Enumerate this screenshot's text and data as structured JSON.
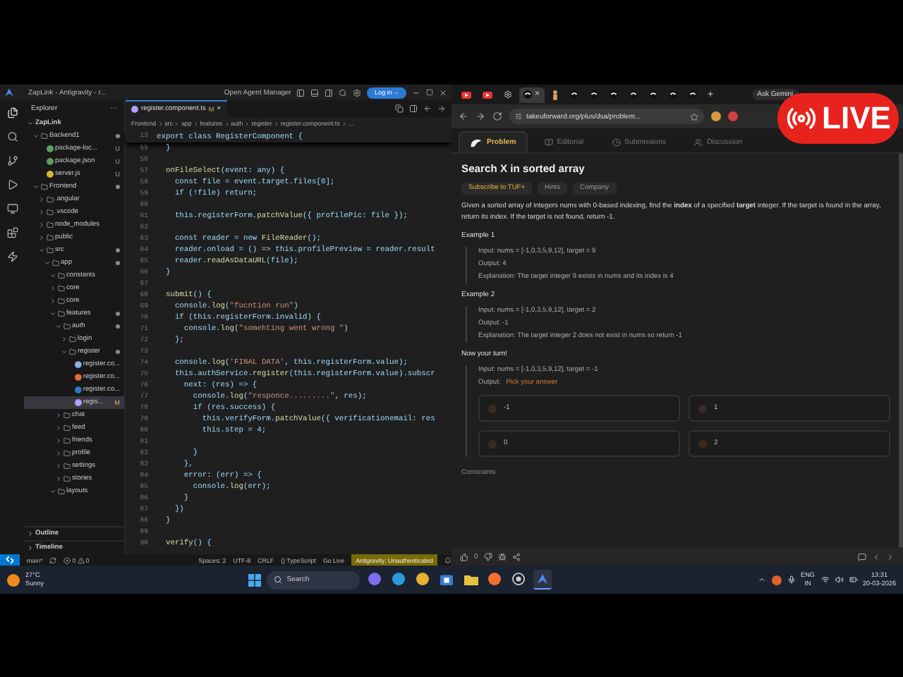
{
  "vscode": {
    "title": "ZapLink - Antigravity - r...",
    "agent_manager": "Open Agent Manager",
    "login_button": "Log in",
    "explorer": {
      "title": "Explorer",
      "more": "···",
      "tree": [
        {
          "label": "ZapLink",
          "kind": "root",
          "expanded": true,
          "selected": false,
          "dot": false,
          "children": [
            {
              "label": "Backend1",
              "kind": "folder",
              "expanded": true,
              "selected": false,
              "dot": true,
              "children": [
                {
                  "label": "package-loc...",
                  "kind": "json",
                  "selected": false,
                  "dot": false,
                  "badge": "U"
                },
                {
                  "label": "package.json",
                  "kind": "json",
                  "selected": false,
                  "dot": false,
                  "badge": "U"
                },
                {
                  "label": "server.js",
                  "kind": "js",
                  "selected": false,
                  "dot": false,
                  "badge": "U"
                }
              ]
            },
            {
              "label": "Frontend",
              "kind": "folder",
              "expanded": true,
              "selected": false,
              "dot": true,
              "children": [
                {
                  "label": ".angular",
                  "kind": "folder",
                  "expanded": false,
                  "selected": false,
                  "dot": false
                },
                {
                  "label": ".vscode",
                  "kind": "folder",
                  "expanded": false,
                  "selected": false,
                  "dot": false
                },
                {
                  "label": "node_modules",
                  "kind": "folder",
                  "expanded": false,
                  "selected": false,
                  "dot": false
                },
                {
                  "label": "public",
                  "kind": "folder",
                  "expanded": false,
                  "selected": false,
                  "dot": false
                },
                {
                  "label": "src",
                  "kind": "folder",
                  "expanded": true,
                  "selected": false,
                  "dot": true,
                  "children": [
                    {
                      "label": "app",
                      "kind": "folder",
                      "expanded": true,
                      "selected": false,
                      "dot": true,
                      "children": [
                        {
                          "label": "constants",
                          "kind": "folder",
                          "expanded": true,
                          "selected": false,
                          "dot": false
                        },
                        {
                          "label": "core",
                          "kind": "folder",
                          "expanded": false,
                          "selected": false,
                          "dot": false
                        },
                        {
                          "label": "core",
                          "kind": "folder",
                          "expanded": false,
                          "selected": false,
                          "dot": false
                        },
                        {
                          "label": "features",
                          "kind": "folder",
                          "expanded": true,
                          "selected": false,
                          "dot": true,
                          "children": [
                            {
                              "label": "auth",
                              "kind": "folder",
                              "expanded": true,
                              "selected": false,
                              "dot": true,
                              "children": [
                                {
                                  "label": "login",
                                  "kind": "folder",
                                  "expanded": false,
                                  "selected": false,
                                  "dot": false
                                },
                                {
                                  "label": "register",
                                  "kind": "folder",
                                  "expanded": true,
                                  "selected": false,
                                  "dot": true,
                                  "children": [
                                    {
                                      "label": "register.co...",
                                      "kind": "braces",
                                      "selected": false,
                                      "dot": false
                                    },
                                    {
                                      "label": "register.co...",
                                      "kind": "html",
                                      "selected": false,
                                      "dot": false
                                    },
                                    {
                                      "label": "register.co...",
                                      "kind": "ts",
                                      "selected": false,
                                      "dot": false
                                    },
                                    {
                                      "label": "regis...",
                                      "kind": "angular",
                                      "selected": true,
                                      "dot": false,
                                      "badge": "M"
                                    }
                                  ]
                                }
                              ]
                            },
                            {
                              "label": "chat",
                              "kind": "folder",
                              "expanded": false,
                              "selected": false,
                              "dot": false
                            },
                            {
                              "label": "feed",
                              "kind": "folder",
                              "expanded": false,
                              "selected": false,
                              "dot": false
                            },
                            {
                              "label": "friends",
                              "kind": "folder",
                              "expanded": false,
                              "selected": false,
                              "dot": false
                            },
                            {
                              "label": "profile",
                              "kind": "folder",
                              "expanded": false,
                              "selected": false,
                              "dot": false
                            },
                            {
                              "label": "settings",
                              "kind": "folder",
                              "expanded": false,
                              "selected": false,
                              "dot": false
                            },
                            {
                              "label": "stories",
                              "kind": "folder",
                              "expanded": false,
                              "selected": false,
                              "dot": false
                            }
                          ]
                        },
                        {
                          "label": "layouts",
                          "kind": "folder",
                          "expanded": true,
                          "selected": false,
                          "dot": false
                        }
                      ]
                    }
                  ]
                }
              ]
            }
          ]
        }
      ],
      "sections": [
        "Outline",
        "Timeline"
      ]
    },
    "tab": {
      "label": "register.component.ts",
      "badge": "M",
      "close": "×"
    },
    "breadcrumbs": [
      "Frontend",
      "src",
      "app",
      "features",
      "auth",
      "register",
      "register.component.ts",
      "..."
    ],
    "sticky": {
      "n": "13",
      "text": "export class RegisterComponent {"
    },
    "lines": [
      {
        "n": "55",
        "text": "  }"
      },
      {
        "n": "56"
      },
      {
        "n": "57",
        "text": "  onFileSelect(event: any) {"
      },
      {
        "n": "58",
        "text": "    const file = event.target.files[0];"
      },
      {
        "n": "59",
        "text": "    if (!file) return;"
      },
      {
        "n": "60"
      },
      {
        "n": "61",
        "text": "    this.registerForm.patchValue({ profilePic: file });"
      },
      {
        "n": "62"
      },
      {
        "n": "63",
        "text": "    const reader = new FileReader();"
      },
      {
        "n": "64",
        "text": "    reader.onload = () => this.profilePreview = reader.result"
      },
      {
        "n": "65",
        "text": "    reader.readAsDataURL(file);"
      },
      {
        "n": "66",
        "text": "  }"
      },
      {
        "n": "67"
      },
      {
        "n": "68",
        "text": "  submit() {"
      },
      {
        "n": "69",
        "text": "    console.log(\"fucntion run\")"
      },
      {
        "n": "70",
        "text": "    if (this.registerForm.invalid) {"
      },
      {
        "n": "71",
        "text": "      console.log(\"somehting went wrong \")"
      },
      {
        "n": "72",
        "text": "    };"
      },
      {
        "n": "73"
      },
      {
        "n": "74",
        "text": "    console.log('FINAL DATA', this.registerForm.value);"
      },
      {
        "n": "75",
        "text": "    this.authService.register(this.registerForm.value).subscr"
      },
      {
        "n": "76",
        "text": "      next: (res) => {"
      },
      {
        "n": "77",
        "text": "        console.log(\"responce.........\", res);"
      },
      {
        "n": "78",
        "text": "        if (res.success) {"
      },
      {
        "n": "79",
        "text": "          this.verifyForm.patchValue({ verificationemail: res"
      },
      {
        "n": "80",
        "text": "          this.step = 4;"
      },
      {
        "n": "81"
      },
      {
        "n": "82",
        "text": "        }"
      },
      {
        "n": "83",
        "text": "      },"
      },
      {
        "n": "84",
        "text": "      error: (err) => {"
      },
      {
        "n": "85",
        "text": "        console.log(err);"
      },
      {
        "n": "86",
        "text": "      }"
      },
      {
        "n": "87",
        "text": "    })"
      },
      {
        "n": "88",
        "text": "  }"
      },
      {
        "n": "89"
      },
      {
        "n": "90",
        "text": "  verify() {"
      }
    ],
    "status_bar": {
      "branch": "main*",
      "errors": "0",
      "warnings": "0",
      "items": [
        "Spaces: 2",
        "UTF-8",
        "CRLF",
        "{} TypeScript",
        "Go Live"
      ],
      "auth": "Antigravity: Unauthenticated"
    }
  },
  "browser": {
    "tabs": [
      {
        "kind": "youtube",
        "selected": false
      },
      {
        "kind": "youtube",
        "selected": false
      },
      {
        "kind": "settings",
        "selected": false
      },
      {
        "kind": "tuf",
        "selected": true
      },
      {
        "kind": "figure",
        "selected": false
      },
      {
        "kind": "tuf",
        "selected": false
      },
      {
        "kind": "tuf",
        "selected": false
      },
      {
        "kind": "tuf",
        "selected": false
      },
      {
        "kind": "tuf",
        "selected": false
      },
      {
        "kind": "tuf",
        "selected": false
      },
      {
        "kind": "tuf",
        "selected": false
      },
      {
        "kind": "tuf",
        "selected": false
      }
    ],
    "tab_close": "×",
    "new_tab": "+",
    "gemini": "Ask Gemini",
    "url": "takeuforward.org/plus/dsa/problem...",
    "page": {
      "tabs": [
        {
          "label": "Problem",
          "kind": "problem",
          "selected": true
        },
        {
          "label": "Editorial",
          "kind": "editorial",
          "selected": false
        },
        {
          "label": "Submissions",
          "kind": "submissions",
          "selected": false
        },
        {
          "label": "Discussion",
          "kind": "discussion",
          "selected": false
        }
      ],
      "title": "Search X in sorted array",
      "chips": [
        {
          "label": "Subscribe to TUF+",
          "kind": "premium"
        },
        {
          "label": "Hints",
          "kind": "plain"
        },
        {
          "label": "Company",
          "kind": "plain"
        }
      ],
      "description": "Given a sorted array of integers nums with 0-based indexing, find the **index** of a specified **target** integer. If the target is found in the array, return its index. If the target is not found, return -1.",
      "examples": [
        {
          "heading": "Example 1",
          "lines": [
            "Input: nums = [-1,0,3,5,9,12], target = 9",
            "Output: 4",
            "Explanation: The target integer 9 exists in nums and its index is 4"
          ]
        },
        {
          "heading": "Example 2",
          "lines": [
            "Input: nums = [-1,0,3,5,9,12], target = 2",
            "Output: -1",
            "Explanation: The target integer 2 does not exist in nums so return -1"
          ]
        }
      ],
      "quiz": {
        "heading": "Now your turn!",
        "input": "Input: nums = [-1,0,3,5,9,12], target = -1",
        "output_label": "Output:",
        "prompt": "Pick your answer",
        "options": [
          {
            "label": "-1",
            "selected": false
          },
          {
            "label": "1",
            "selected": false
          },
          {
            "label": "0",
            "selected": false
          },
          {
            "label": "2",
            "selected": false
          }
        ]
      },
      "constraints": "Constraints",
      "likes": "0"
    }
  },
  "live_badge": "LIVE",
  "taskbar": {
    "temperature": "27°C",
    "weather": "Sunny",
    "search": "Search",
    "apps": [
      {
        "kind": "copilot",
        "selected": false
      },
      {
        "kind": "edge",
        "selected": false
      },
      {
        "kind": "chrome",
        "selected": false
      },
      {
        "kind": "store",
        "selected": false
      },
      {
        "kind": "files",
        "selected": false
      },
      {
        "kind": "brave",
        "selected": false
      },
      {
        "kind": "obs",
        "selected": false
      },
      {
        "kind": "antigravity",
        "selected": true
      }
    ],
    "language": "ENG",
    "region": "IN",
    "time": "13:31",
    "date": "20-03-2026"
  }
}
